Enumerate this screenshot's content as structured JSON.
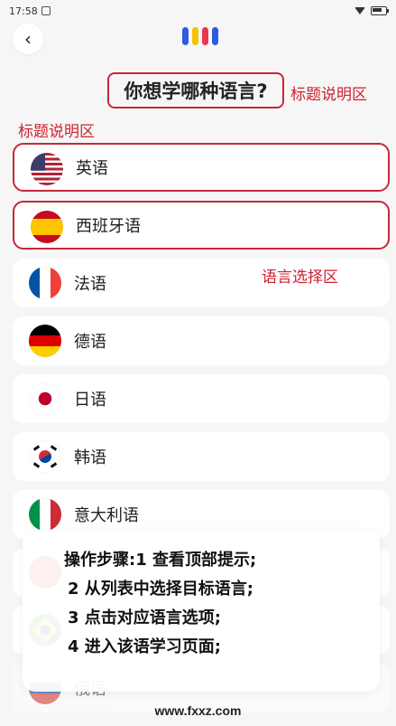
{
  "status_bar": {
    "time": "17:58",
    "notification_icon": "message-icon",
    "wifi_icon": "wifi-icon",
    "battery_icon": "battery-icon"
  },
  "header": {
    "back_icon": "chevron-left-icon",
    "back_glyph": "‹",
    "logo_colors": [
      "#2f5be0",
      "#f5c200",
      "#e8384f",
      "#2f5be0"
    ]
  },
  "title": {
    "text": "你想学哪种语言?"
  },
  "annotations": {
    "title_right": "标题说明区",
    "title_left": "标题说明区",
    "list_area": "语言选择区"
  },
  "languages": [
    {
      "label": "英语",
      "flag": "us-flag-icon",
      "highlighted": true
    },
    {
      "label": "西班牙语",
      "flag": "spain-flag-icon",
      "highlighted": true
    },
    {
      "label": "法语",
      "flag": "france-flag-icon",
      "highlighted": false
    },
    {
      "label": "德语",
      "flag": "germany-flag-icon",
      "highlighted": false
    },
    {
      "label": "日语",
      "flag": "japan-flag-icon",
      "highlighted": false
    },
    {
      "label": "韩语",
      "flag": "korea-flag-icon",
      "highlighted": false
    },
    {
      "label": "意大利语",
      "flag": "italy-flag-icon",
      "highlighted": false
    },
    {
      "label": "",
      "flag": "china-flag-icon",
      "highlighted": false
    },
    {
      "label": "",
      "flag": "brazil-flag-icon",
      "highlighted": false
    },
    {
      "label": "俄语",
      "flag": "russia-flag-icon",
      "highlighted": false
    }
  ],
  "steps": {
    "line1": "操作步骤:1 查看顶部提示;",
    "line2": "2 从列表中选择目标语言;",
    "line3": "3 点击对应语言选项;",
    "line4": "4 进入该语学习页面;"
  },
  "watermark": "www.fxxz.com",
  "colors": {
    "accent_border": "#c8273b",
    "annotation_text": "#d0202e"
  }
}
